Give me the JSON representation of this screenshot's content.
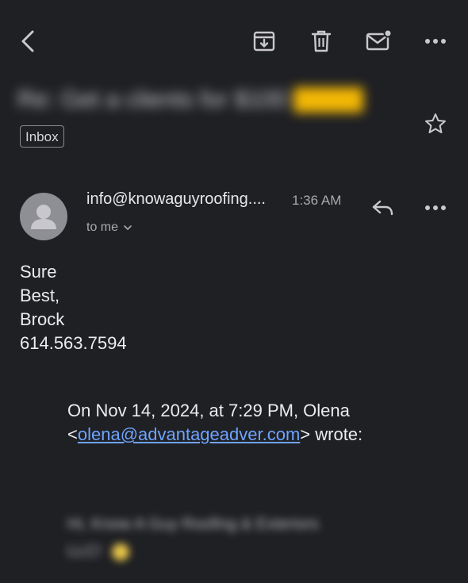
{
  "toolbar": {
    "back_icon": "chevron-left-icon",
    "archive_icon": "archive-icon",
    "delete_icon": "trash-icon",
    "mark_unread_icon": "mail-unread-icon",
    "more_icon": "more-horizontal-icon"
  },
  "subject": {
    "text": "Re: Get a clients for $100",
    "highlight": "",
    "star_icon": "star-outline-icon"
  },
  "labels": {
    "inbox": "Inbox"
  },
  "message": {
    "sender": "info@knowaguyroofing....",
    "time": "1:36 AM",
    "recipient": "to me",
    "reply_icon": "reply-icon",
    "more_icon": "more-horizontal-icon",
    "body_lines": [
      "Sure",
      "Best,",
      "Brock",
      "614.563.7594"
    ],
    "quote_line1": "On Nov 14, 2024, at 7:29 PM, Olena",
    "quote_email": "olena@advantageadver.com",
    "quote_open": "<",
    "quote_close": "> wrote:",
    "blurred_line1": "Hi, Know A Guy Roofing & Exteriors",
    "blurred_line2": "LLC!"
  },
  "colors": {
    "background": "#1f2024",
    "link": "#6ea4ff",
    "subject_highlight": "#f2b705"
  }
}
